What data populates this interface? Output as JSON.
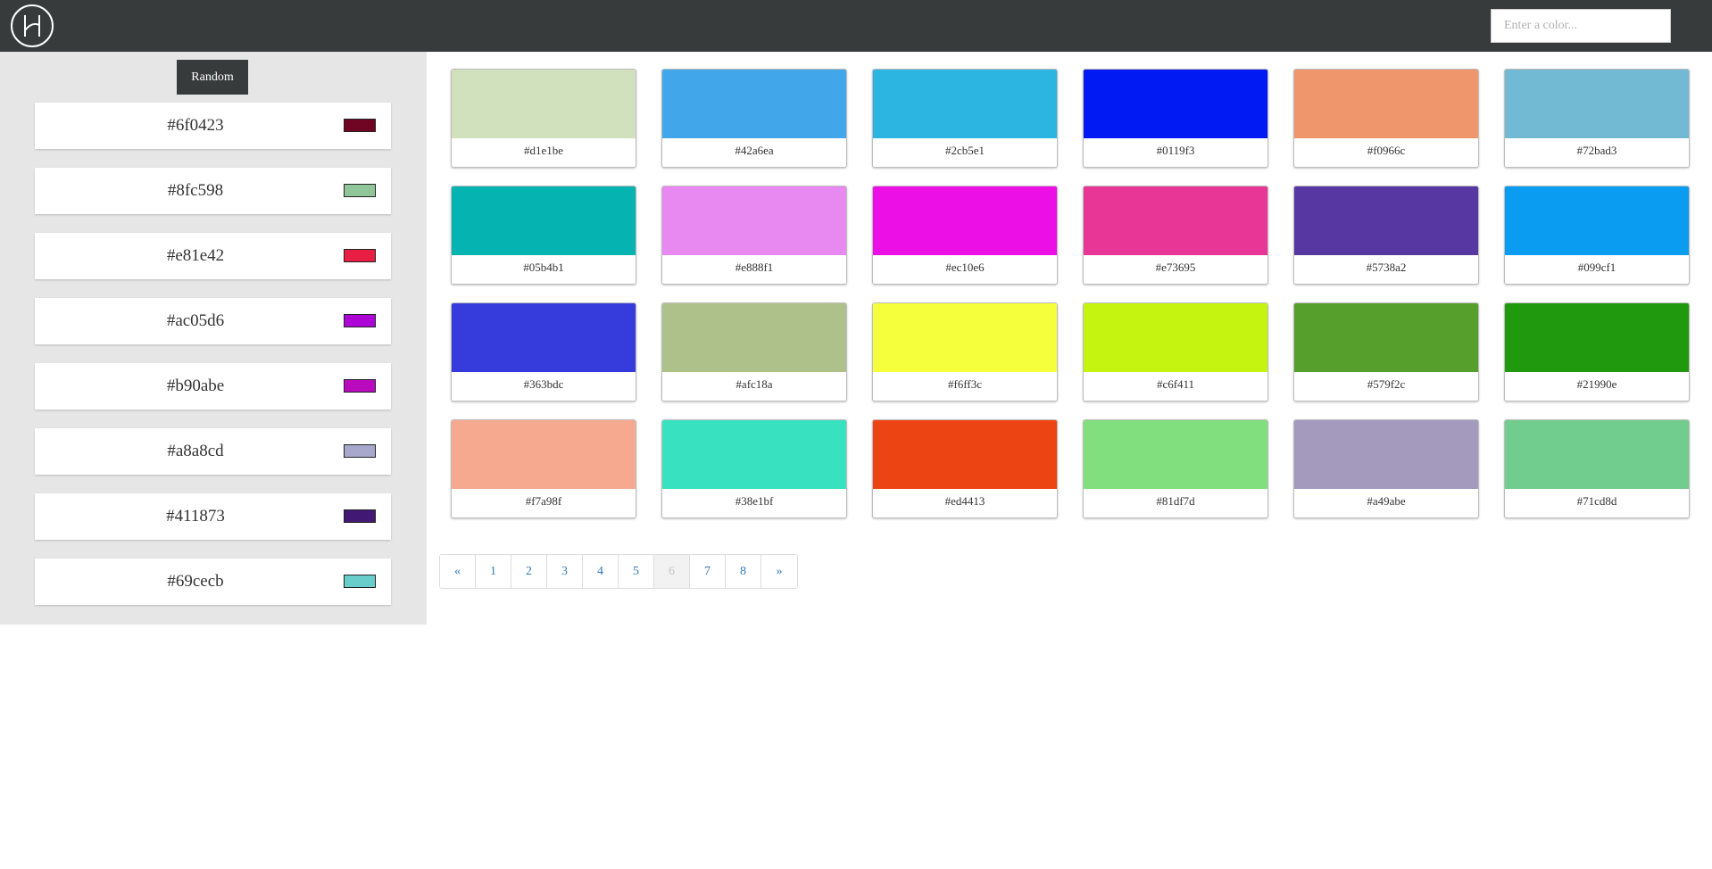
{
  "search": {
    "placeholder": "Enter a color..."
  },
  "sidebar": {
    "random_label": "Random",
    "items": [
      {
        "hex": "#6f0423",
        "color": "#6f0423"
      },
      {
        "hex": "#8fc598",
        "color": "#8fc598"
      },
      {
        "hex": "#e81e42",
        "color": "#e81e42"
      },
      {
        "hex": "#ac05d6",
        "color": "#ac05d6"
      },
      {
        "hex": "#b90abe",
        "color": "#b90abe"
      },
      {
        "hex": "#a8a8cd",
        "color": "#a8a8cd"
      },
      {
        "hex": "#411873",
        "color": "#411873"
      },
      {
        "hex": "#69cecb",
        "color": "#69cecb"
      }
    ]
  },
  "grid": {
    "cards": [
      {
        "label": "#d1e1be",
        "color": "#d1e1be"
      },
      {
        "label": "#42a6ea",
        "color": "#42a6ea"
      },
      {
        "label": "#2cb5e1",
        "color": "#2cb5e1"
      },
      {
        "label": "#0119f3",
        "color": "#0119f3"
      },
      {
        "label": "#f0966c",
        "color": "#f0966c"
      },
      {
        "label": "#72bad3",
        "color": "#72bad3"
      },
      {
        "label": "#05b4b1",
        "color": "#05b4b1"
      },
      {
        "label": "#e888f1",
        "color": "#e888f1"
      },
      {
        "label": "#ec10e6",
        "color": "#ec10e6"
      },
      {
        "label": "#e73695",
        "color": "#e73695"
      },
      {
        "label": "#5738a2",
        "color": "#5738a2"
      },
      {
        "label": "#099cf1",
        "color": "#099cf1"
      },
      {
        "label": "#363bdc",
        "color": "#363bdc"
      },
      {
        "label": "#afc18a",
        "color": "#afc18a"
      },
      {
        "label": "#f6ff3c",
        "color": "#f6ff3c"
      },
      {
        "label": "#c6f411",
        "color": "#c6f411"
      },
      {
        "label": "#579f2c",
        "color": "#579f2c"
      },
      {
        "label": "#21990e",
        "color": "#21990e"
      },
      {
        "label": "#f7a98f",
        "color": "#f7a98f"
      },
      {
        "label": "#38e1bf",
        "color": "#38e1bf"
      },
      {
        "label": "#ed4413",
        "color": "#ed4413"
      },
      {
        "label": "#81df7d",
        "color": "#81df7d"
      },
      {
        "label": "#a49abe",
        "color": "#a49abe"
      },
      {
        "label": "#71cd8d",
        "color": "#71cd8d"
      }
    ]
  },
  "pagination": {
    "prev": "«",
    "next": "»",
    "pages": [
      "1",
      "2",
      "3",
      "4",
      "5",
      "6",
      "7",
      "8"
    ],
    "current": "6"
  }
}
